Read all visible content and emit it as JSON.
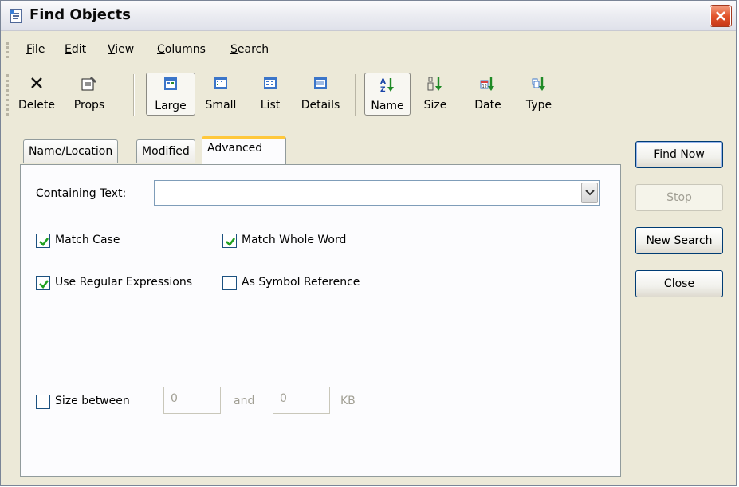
{
  "window": {
    "title": "Find Objects"
  },
  "menu": [
    {
      "label": "File"
    },
    {
      "label": "Edit"
    },
    {
      "label": "View"
    },
    {
      "label": "Columns"
    },
    {
      "label": "Search"
    }
  ],
  "toolbar": {
    "delete": "Delete",
    "props": "Props",
    "large": "Large",
    "small": "Small",
    "list": "List",
    "details": "Details",
    "name": "Name",
    "size": "Size",
    "date": "Date",
    "type": "Type"
  },
  "tabs": {
    "name_location": "Name/Location",
    "modified": "Modified",
    "advanced": "Advanced"
  },
  "advanced": {
    "containing_text_label": "Containing Text:",
    "containing_text_value": "",
    "match_case": "Match Case",
    "match_case_checked": true,
    "match_whole_word": "Match Whole Word",
    "match_whole_word_checked": true,
    "use_regex": "Use Regular Expressions",
    "use_regex_checked": true,
    "symbol_ref": "As Symbol Reference",
    "symbol_ref_checked": false,
    "size_between": "Size between",
    "size_between_checked": false,
    "size_min": "0",
    "and": "and",
    "size_max": "0",
    "unit": "KB"
  },
  "buttons": {
    "find_now": "Find Now",
    "stop": "Stop",
    "new_search": "New Search",
    "close": "Close"
  },
  "colors": {
    "accent_tab": "#ffc83c",
    "window_bg": "#ece9d8",
    "close_red": "#e2542b"
  }
}
